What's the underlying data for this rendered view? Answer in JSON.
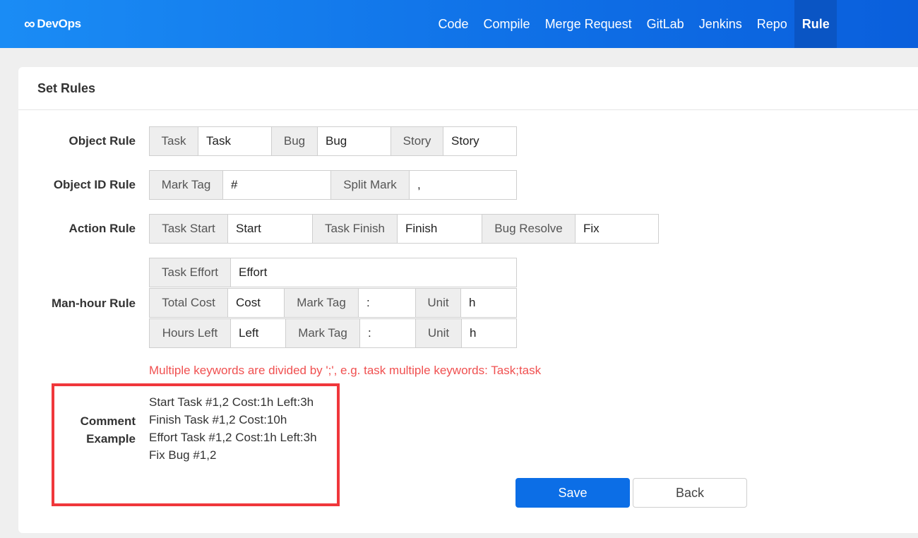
{
  "brand": {
    "icon": "infinity-icon",
    "name": "DevOps"
  },
  "nav": {
    "items": [
      {
        "label": "Code"
      },
      {
        "label": "Compile"
      },
      {
        "label": "Merge Request"
      },
      {
        "label": "GitLab"
      },
      {
        "label": "Jenkins"
      },
      {
        "label": "Repo"
      },
      {
        "label": "Rule",
        "active": true
      }
    ]
  },
  "card": {
    "title": "Set Rules"
  },
  "object_rule": {
    "label": "Object Rule",
    "task_addon": "Task",
    "task_value": "Task",
    "bug_addon": "Bug",
    "bug_value": "Bug",
    "story_addon": "Story",
    "story_value": "Story"
  },
  "object_id_rule": {
    "label": "Object ID Rule",
    "mark_tag_addon": "Mark Tag",
    "mark_tag_value": "#",
    "split_mark_addon": "Split Mark",
    "split_mark_value": ","
  },
  "action_rule": {
    "label": "Action Rule",
    "task_start_addon": "Task Start",
    "task_start_value": "Start",
    "task_finish_addon": "Task Finish",
    "task_finish_value": "Finish",
    "bug_resolve_addon": "Bug Resolve",
    "bug_resolve_value": "Fix"
  },
  "man_hour_rule": {
    "label": "Man-hour Rule",
    "task_effort_addon": "Task Effort",
    "task_effort_value": "Effort",
    "total_cost": {
      "addon": "Total Cost",
      "value": "Cost",
      "mark_tag_addon": "Mark Tag",
      "mark_tag_value": ":",
      "unit_addon": "Unit",
      "unit_value": "h"
    },
    "hours_left": {
      "addon": "Hours Left",
      "value": "Left",
      "mark_tag_addon": "Mark Tag",
      "mark_tag_value": ":",
      "unit_addon": "Unit",
      "unit_value": "h"
    }
  },
  "hint": "Multiple keywords are divided by ';', e.g. task multiple keywords: Task;task",
  "comment_example": {
    "label_line1": "Comment",
    "label_line2": "Example",
    "lines": [
      "Start Task #1,2 Cost:1h Left:3h",
      "Finish Task #1,2 Cost:10h",
      "Effort Task #1,2 Cost:1h Left:3h",
      "Fix Bug #1,2"
    ]
  },
  "buttons": {
    "save": "Save",
    "back": "Back"
  },
  "colors": {
    "nav_gradient_start": "#1a8cf5",
    "nav_gradient_end": "#0a5fdc",
    "nav_active": "#0a55c4",
    "primary": "#0c6ee6",
    "hint_red": "#f05050",
    "highlight_red": "#f0373b"
  }
}
